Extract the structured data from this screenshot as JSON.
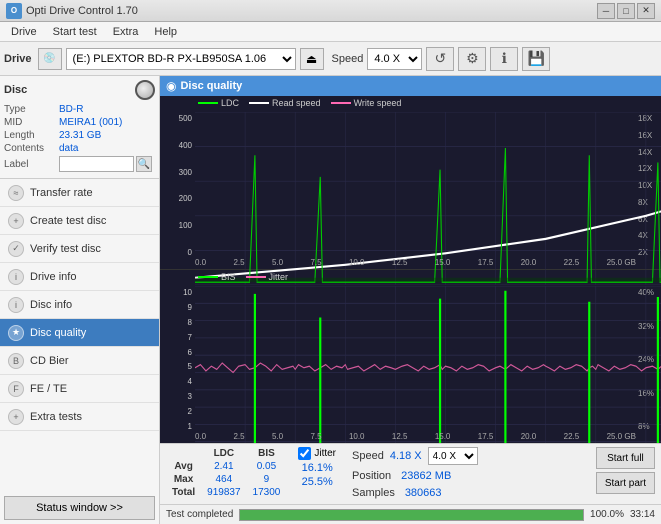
{
  "app": {
    "title": "Opti Drive Control 1.70",
    "icon": "O"
  },
  "titlebar": {
    "minimize": "─",
    "maximize": "□",
    "close": "✕"
  },
  "menu": {
    "items": [
      "Drive",
      "Start test",
      "Extra",
      "Help"
    ]
  },
  "toolbar": {
    "drive_label": "Drive",
    "drive_value": "(E:)  PLEXTOR BD-R  PX-LB950SA 1.06",
    "speed_label": "Speed",
    "speed_value": "4.0 X"
  },
  "sidebar": {
    "disc_section": {
      "title": "Disc",
      "rows": [
        {
          "label": "Type",
          "value": "BD-R"
        },
        {
          "label": "MID",
          "value": "MEIRA1 (001)"
        },
        {
          "label": "Length",
          "value": "23.31 GB"
        },
        {
          "label": "Contents",
          "value": "data"
        },
        {
          "label": "Label",
          "value": ""
        }
      ]
    },
    "nav_items": [
      {
        "id": "transfer-rate",
        "label": "Transfer rate",
        "icon": "≈"
      },
      {
        "id": "create-test-disc",
        "label": "Create test disc",
        "icon": "+"
      },
      {
        "id": "verify-test-disc",
        "label": "Verify test disc",
        "icon": "✓"
      },
      {
        "id": "drive-info",
        "label": "Drive info",
        "icon": "i"
      },
      {
        "id": "disc-info",
        "label": "Disc info",
        "icon": "i"
      },
      {
        "id": "disc-quality",
        "label": "Disc quality",
        "icon": "★",
        "active": true
      },
      {
        "id": "cd-bier",
        "label": "CD Bier",
        "icon": "B"
      },
      {
        "id": "fe-te",
        "label": "FE / TE",
        "icon": "F"
      },
      {
        "id": "extra-tests",
        "label": "Extra tests",
        "icon": "+"
      }
    ],
    "status_window_btn": "Status window >>"
  },
  "disc_quality": {
    "title": "Disc quality",
    "legend": {
      "ldc": "LDC",
      "read_speed": "Read speed",
      "write_speed": "Write speed"
    },
    "legend2": {
      "bis": "BIS",
      "jitter": "Jitter"
    },
    "top_chart": {
      "y_left": [
        "500",
        "400",
        "300",
        "200",
        "100",
        "0"
      ],
      "y_right": [
        "18X",
        "16X",
        "14X",
        "12X",
        "10X",
        "8X",
        "6X",
        "4X",
        "2X"
      ],
      "x_axis": [
        "0.0",
        "2.5",
        "5.0",
        "7.5",
        "10.0",
        "12.5",
        "15.0",
        "17.5",
        "20.0",
        "22.5",
        "25.0 GB"
      ]
    },
    "bottom_chart": {
      "y_left": [
        "10",
        "9",
        "8",
        "7",
        "6",
        "5",
        "4",
        "3",
        "2",
        "1"
      ],
      "y_right": [
        "40%",
        "32%",
        "24%",
        "16%",
        "8%"
      ],
      "x_axis": [
        "0.0",
        "2.5",
        "5.0",
        "7.5",
        "10.0",
        "12.5",
        "15.0",
        "17.5",
        "20.0",
        "22.5",
        "25.0 GB"
      ]
    }
  },
  "stats": {
    "headers": [
      "",
      "LDC",
      "BIS",
      "",
      "Jitter",
      "Speed",
      "4.18 X",
      "",
      "4.0 X"
    ],
    "rows": [
      {
        "label": "Avg",
        "ldc": "2.41",
        "bis": "0.05",
        "jitter": "16.1%"
      },
      {
        "label": "Max",
        "ldc": "464",
        "bis": "9",
        "jitter": "25.5%"
      },
      {
        "label": "Total",
        "ldc": "919837",
        "bis": "17300",
        "jitter": ""
      }
    ],
    "position_label": "Position",
    "position_value": "23862 MB",
    "samples_label": "Samples",
    "samples_value": "380663",
    "jitter_checked": true,
    "jitter_label": "Jitter",
    "speed_label": "Speed",
    "speed_value": "4.18 X",
    "speed_select": "4.0 X",
    "btn_full": "Start full",
    "btn_part": "Start part"
  },
  "progress": {
    "status": "Test completed",
    "percent": 100,
    "percent_text": "100.0%",
    "time": "33:14"
  }
}
